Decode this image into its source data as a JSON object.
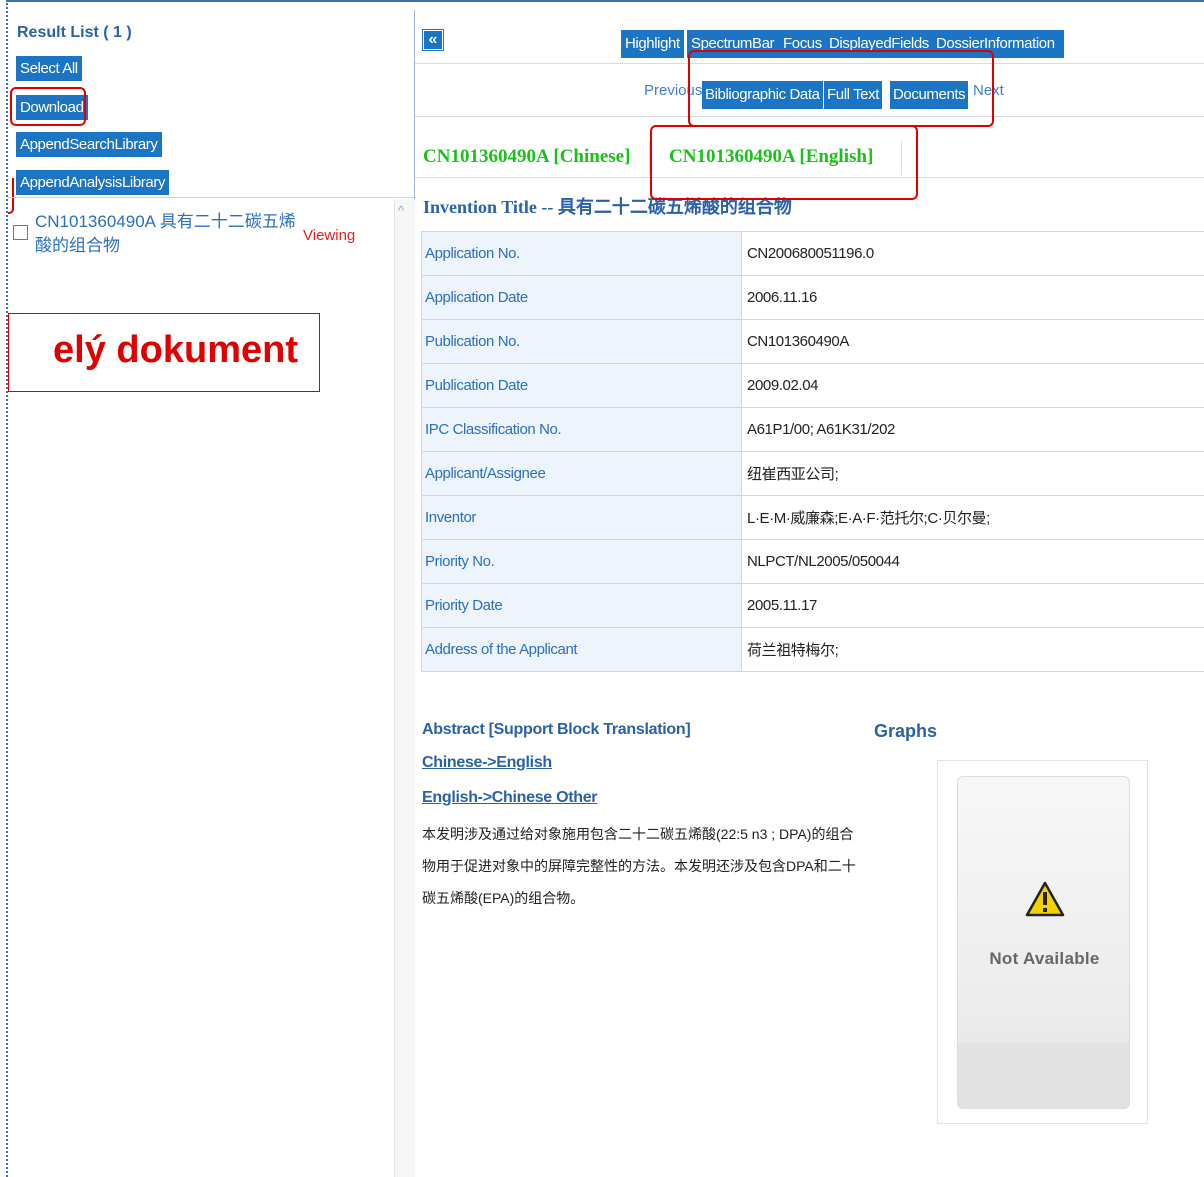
{
  "left_pane": {
    "title": "Result List ( 1 )",
    "buttons": {
      "select_all": "Select All",
      "download": "Download",
      "append_search_library": "AppendSearchLibrary",
      "append_analysis_library": "AppendAnalysisLibrary"
    },
    "results": [
      {
        "text": "CN101360490A 具有二十二碳五烯酸的组合物",
        "status": "Viewing",
        "checked": false
      }
    ],
    "annotation_text": "elý dokument"
  },
  "right_pane": {
    "toolbar": {
      "collapse_icon": "double-chevron-left-icon",
      "highlight": "Highlight",
      "spectrum_bar": "SpectrumBar",
      "focus": "Focus",
      "displayed_fields": "DisplayedFields",
      "dossier_information": "DossierInformation"
    },
    "nav": {
      "previous": "Previous",
      "bibliographic_data": "Bibliographic Data",
      "full_text": "Full Text",
      "documents": "Documents",
      "next": "Next"
    },
    "language_tabs": {
      "chinese": "CN101360490A [Chinese]",
      "english": "CN101360490A [English]"
    },
    "invention_title": "Invention Title -- 具有二十二碳五烯酸的组合物",
    "biblio": [
      {
        "label": "Application No.",
        "value": "CN200680051196.0"
      },
      {
        "label": "Application Date",
        "value": "2006.11.16"
      },
      {
        "label": "Publication No.",
        "value": "CN101360490A"
      },
      {
        "label": "Publication Date",
        "value": "2009.02.04"
      },
      {
        "label": "IPC Classification No.",
        "value": "A61P1/00; A61K31/202"
      },
      {
        "label": "Applicant/Assignee",
        "value": "纽崔西亚公司;"
      },
      {
        "label": "Inventor",
        "value": "L·E·M·威廉森;E·A·F·范托尔;C·贝尔曼;"
      },
      {
        "label": "Priority No.",
        "value": "NLPCT/NL2005/050044"
      },
      {
        "label": "Priority Date",
        "value": "2005.11.17"
      },
      {
        "label": "Address of the Applicant",
        "value": "荷兰祖特梅尔;"
      }
    ],
    "abstract": {
      "heading": "Abstract [Support Block Translation]",
      "link_chinese_english": "Chinese->English",
      "link_english_chinese": "English->Chinese",
      "link_other": "Other",
      "text": "本发明涉及通过给对象施用包含二十二碳五烯酸(22:5 n3 ; DPA)的组合物用于促进对象中的屏障完整性的方法。本发明还涉及包含DPA和二十碳五烯酸(EPA)的组合物。"
    },
    "graphs": {
      "heading": "Graphs",
      "placeholder_text": "Not Available",
      "icon": "warning-icon"
    }
  },
  "colors": {
    "button_blue": "#1b74c4",
    "link_blue": "#2a62a8",
    "tab_green": "#19c219",
    "annotation_red": "#e00000"
  }
}
